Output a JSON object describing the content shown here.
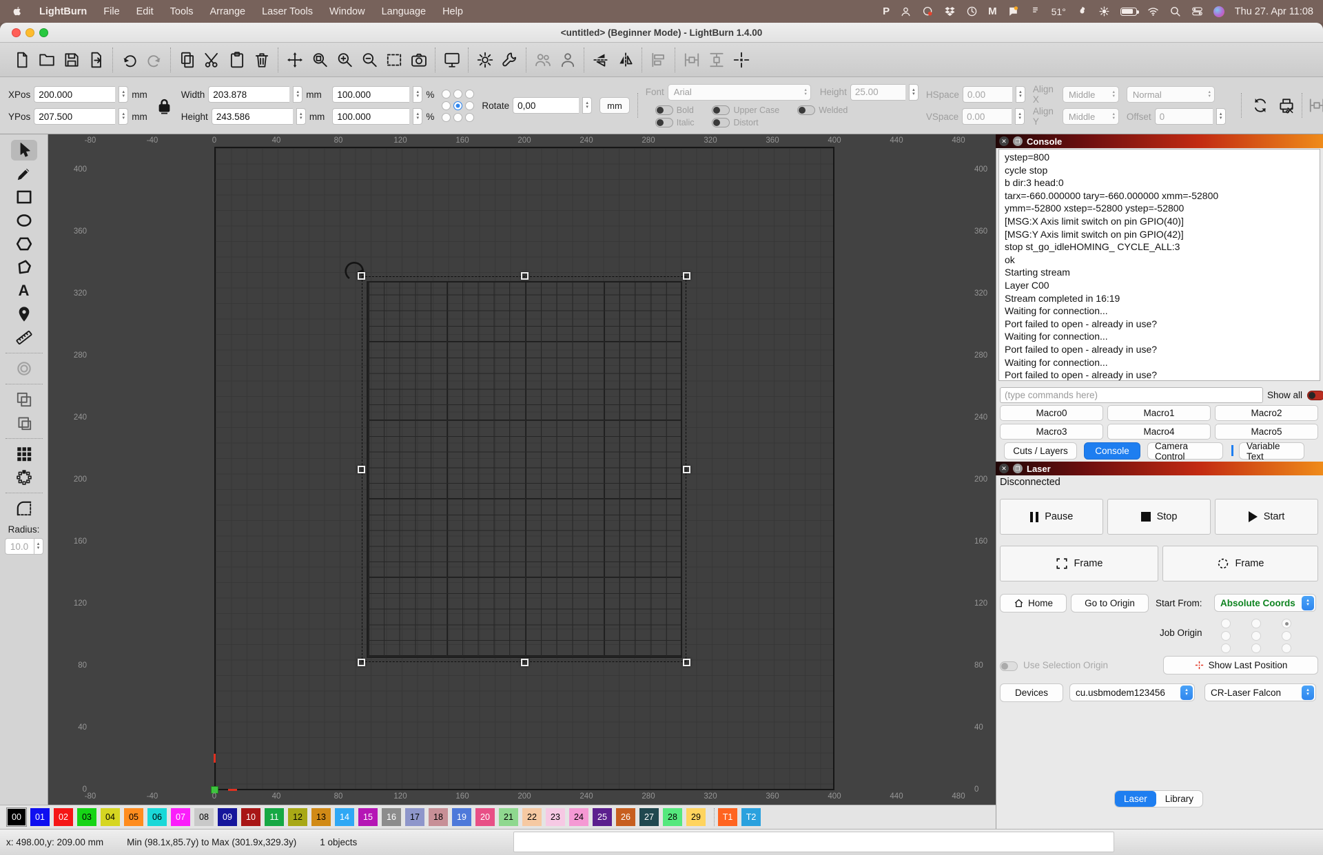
{
  "menu_bar": {
    "items": [
      "LightBurn",
      "File",
      "Edit",
      "Tools",
      "Arrange",
      "Laser Tools",
      "Window",
      "Language",
      "Help"
    ],
    "status_icons": [
      "pastebin-icon",
      "user-status-icon",
      "vpn-icon",
      "dropbox-icon",
      "clock-icon",
      "gmail-icon",
      "notification-icon",
      "thermometer-icon",
      "flame-icon",
      "brightness-icon",
      "battery-icon",
      "wifi-icon",
      "search-icon",
      "control-center-icon",
      "siri-icon"
    ],
    "temperature": "51°",
    "datetime": "Thu 27. Apr 11:08"
  },
  "window": {
    "title": "<untitled> (Beginner Mode) - LightBurn 1.4.00"
  },
  "toolbar": {
    "groups": [
      [
        "new-file",
        "open-file",
        "save",
        "export"
      ],
      [
        "undo",
        "redo"
      ],
      [
        "copy",
        "cut",
        "paste",
        "delete"
      ],
      [
        "pan",
        "zoom-to-page",
        "zoom-in",
        "zoom-out",
        "frame-selection",
        "camera-capture"
      ],
      [
        "preview"
      ],
      [
        "settings",
        "device-settings"
      ],
      [
        "group",
        "ungroup"
      ],
      [
        "flip-vertical",
        "flip-horizontal"
      ],
      [
        "align"
      ],
      [
        "distribute-horizontal",
        "distribute-vertical",
        "move-to-position"
      ]
    ],
    "disabled": [
      "redo",
      "group",
      "align",
      "distribute-horizontal",
      "distribute-vertical"
    ],
    "dim": [
      "ungroup"
    ],
    "overflow": "»"
  },
  "transform_bar": {
    "xpos_label": "XPos",
    "xpos": "200.000",
    "ypos_label": "YPos",
    "ypos": "207.500",
    "width_label": "Width",
    "width": "203.878",
    "height_label": "Height",
    "height": "243.586",
    "width_pct": "100.000",
    "height_pct": "100.000",
    "unit": "mm",
    "pct": "%",
    "rotate_label": "Rotate",
    "rotate": "0,00",
    "unit_button": "mm"
  },
  "font_bar": {
    "font_label": "Font",
    "font_value": "Arial",
    "height_label": "Height",
    "height_value": "25.00",
    "bold": "Bold",
    "italic": "Italic",
    "upper_case": "Upper Case",
    "distort": "Distort",
    "welded": "Welded",
    "hspace_label": "HSpace",
    "hspace": "0.00",
    "vspace_label": "VSpace",
    "vspace": "0.00",
    "align_x_label": "Align X",
    "align_x": "Middle",
    "align_y_label": "Align Y",
    "align_y": "Middle",
    "style": "Normal",
    "offset_label": "Offset",
    "offset": "0"
  },
  "tool_palette": {
    "tools": [
      "select",
      "draw-lines",
      "rectangle",
      "ellipse",
      "polygon",
      "edit-nodes",
      "edit-text",
      "position-laser",
      "measure",
      "|",
      "offset",
      "|",
      "boolean-union",
      "boolean-difference",
      "|",
      "grid-array",
      "circular-array",
      "|",
      "radius-tool"
    ],
    "selected": "select",
    "disabled": [
      "offset"
    ],
    "dim": [
      "boolean-union",
      "boolean-difference"
    ],
    "radius_label": "Radius:",
    "radius_value": "10.0"
  },
  "canvas": {
    "ruler_x": [
      "-80",
      "-40",
      "0",
      "40",
      "80",
      "120",
      "160",
      "200",
      "240",
      "280",
      "320",
      "360",
      "400",
      "440",
      "480"
    ],
    "ruler_y": [
      "400",
      "360",
      "320",
      "280",
      "240",
      "200",
      "160",
      "120",
      "80",
      "40",
      "0"
    ]
  },
  "console_panel": {
    "title": "Console",
    "log": [
      "ystep=800",
      "cycle stop",
      "b dir:3 head:0",
      "tarx=-660.000000 tary=-660.000000 xmm=-52800",
      "ymm=-52800 xstep=-52800 ystep=-52800",
      "[MSG:X  Axis limit switch on pin GPIO(40)]",
      "[MSG:Y  Axis limit switch on pin GPIO(42)]",
      "stop st_go_idleHOMING_ CYCLE_ALL:3",
      "ok",
      "Starting stream",
      "Layer C00",
      "Stream completed in 16:19",
      "Waiting for connection...",
      "Port failed to open - already in use?",
      "Waiting for connection...",
      "Port failed to open - already in use?",
      "Waiting for connection...",
      "Port failed to open - already in use?"
    ],
    "input_placeholder": "(type commands here)",
    "show_all": "Show all",
    "macros": [
      "Macro0",
      "Macro1",
      "Macro2",
      "Macro3",
      "Macro4",
      "Macro5"
    ],
    "tabs": [
      "Cuts / Layers",
      "Console",
      "Camera Control",
      "Variable Text"
    ],
    "active_tab": "Console"
  },
  "laser_panel": {
    "title": "Laser",
    "status": "Disconnected",
    "pause": "Pause",
    "stop": "Stop",
    "start": "Start",
    "frame_rect": "Frame",
    "frame_circle": "Frame",
    "home": "Home",
    "go_to_origin": "Go to Origin",
    "start_from": "Start From:",
    "start_from_value": "Absolute Coords",
    "job_origin": "Job Origin",
    "use_selection_origin": "Use Selection Origin",
    "show_last_position": "Show Last Position",
    "devices": "Devices",
    "port": "cu.usbmodem123456",
    "device": "CR-Laser Falcon",
    "tabs": [
      "Laser",
      "Library"
    ],
    "active_tab": "Laser"
  },
  "palette": {
    "selected": "00",
    "swatches": [
      {
        "label": "00",
        "color": "#000000",
        "text": "#ffffff"
      },
      {
        "label": "01",
        "color": "#0f0ff0",
        "text": "#ffffff"
      },
      {
        "label": "02",
        "color": "#f51616",
        "text": "#ffffff"
      },
      {
        "label": "03",
        "color": "#16d416",
        "text": "#000000"
      },
      {
        "label": "04",
        "color": "#d6d621",
        "text": "#000000"
      },
      {
        "label": "05",
        "color": "#ff8c1e",
        "text": "#000000"
      },
      {
        "label": "06",
        "color": "#1ad8d8",
        "text": "#000000"
      },
      {
        "label": "07",
        "color": "#fb1efb",
        "text": "#ffffff"
      },
      {
        "label": "08",
        "color": "#c9c9c9",
        "text": "#000000"
      },
      {
        "label": "09",
        "color": "#16169b",
        "text": "#ffffff"
      },
      {
        "label": "10",
        "color": "#a81616",
        "text": "#ffffff"
      },
      {
        "label": "11",
        "color": "#16a844",
        "text": "#ffffff"
      },
      {
        "label": "12",
        "color": "#a8a816",
        "text": "#000000"
      },
      {
        "label": "13",
        "color": "#d18a16",
        "text": "#000000"
      },
      {
        "label": "14",
        "color": "#2fa8f5",
        "text": "#ffffff"
      },
      {
        "label": "15",
        "color": "#b516b5",
        "text": "#ffffff"
      },
      {
        "label": "16",
        "color": "#8c8c8c",
        "text": "#ffffff"
      },
      {
        "label": "17",
        "color": "#8e96cb",
        "text": "#000000"
      },
      {
        "label": "18",
        "color": "#c78f96",
        "text": "#000000"
      },
      {
        "label": "19",
        "color": "#4e79da",
        "text": "#ffffff"
      },
      {
        "label": "20",
        "color": "#e84f86",
        "text": "#ffffff"
      },
      {
        "label": "21",
        "color": "#8fd88f",
        "text": "#000000"
      },
      {
        "label": "22",
        "color": "#f6c9a2",
        "text": "#000000"
      },
      {
        "label": "23",
        "color": "#f6c9e4",
        "text": "#000000"
      },
      {
        "label": "24",
        "color": "#f599d4",
        "text": "#000000"
      },
      {
        "label": "25",
        "color": "#5c1f8e",
        "text": "#ffffff"
      },
      {
        "label": "26",
        "color": "#c75e1f",
        "text": "#ffffff"
      },
      {
        "label": "27",
        "color": "#20484f",
        "text": "#ffffff"
      },
      {
        "label": "28",
        "color": "#55e87d",
        "text": "#000000"
      },
      {
        "label": "29",
        "color": "#ffd45e",
        "text": "#000000"
      },
      {
        "label": "T1",
        "color": "#ff6420",
        "text": "#ffffff"
      },
      {
        "label": "T2",
        "color": "#2aa1de",
        "text": "#ffffff"
      }
    ]
  },
  "status_bar": {
    "position": "x: 498.00,y: 209.00 mm",
    "selection_bounds": "Min (98.1x,85.7y) to Max (301.9x,329.3y)",
    "objects": "1 objects"
  }
}
